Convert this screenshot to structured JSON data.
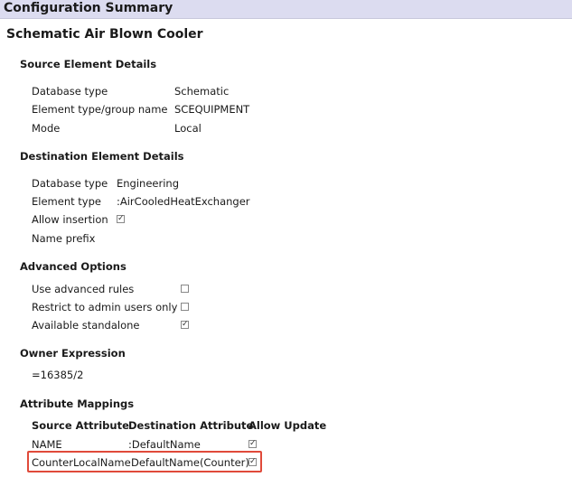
{
  "header": {
    "title": "Configuration Summary"
  },
  "page_title": "Schematic Air Blown Cooler",
  "source": {
    "heading": "Source Element Details",
    "rows": [
      {
        "label": "Database type",
        "value": "Schematic"
      },
      {
        "label": "Element type/group name",
        "value": "SCEQUIPMENT"
      },
      {
        "label": "Mode",
        "value": "Local"
      }
    ]
  },
  "destination": {
    "heading": "Destination Element Details",
    "rows": [
      {
        "label": "Database type",
        "value": "Engineering"
      },
      {
        "label": "Element type",
        "value": ":AirCooledHeatExchanger"
      },
      {
        "label": "Allow insertion",
        "checked": true
      },
      {
        "label": "Name prefix",
        "value": ""
      }
    ]
  },
  "advanced": {
    "heading": "Advanced Options",
    "rows": [
      {
        "label": "Use advanced rules",
        "checked": false
      },
      {
        "label": "Restrict to admin users only",
        "checked": false
      },
      {
        "label": "Available standalone",
        "checked": true
      }
    ]
  },
  "owner": {
    "heading": "Owner Expression",
    "value": "=16385/2"
  },
  "mappings": {
    "heading": "Attribute Mappings",
    "columns": [
      "Source Attribute",
      "Destination Attribute",
      "Allow Update"
    ],
    "rows": [
      {
        "source": "NAME",
        "destination": ":DefaultName",
        "allow_update": true
      },
      {
        "source": "CounterLocalName",
        "destination": "DefaultName(Counter)",
        "allow_update": true
      }
    ]
  },
  "check_glyph": "☑"
}
